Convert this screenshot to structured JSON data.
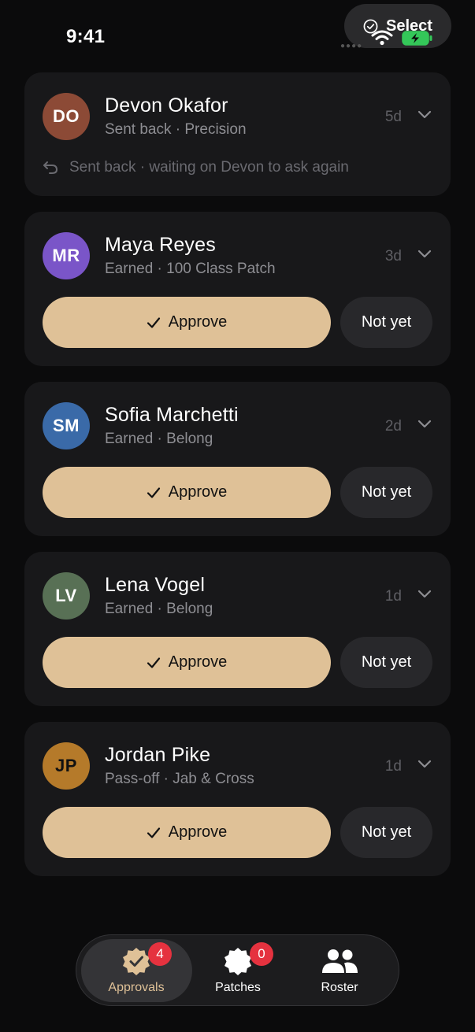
{
  "status_bar": {
    "time": "9:41"
  },
  "header": {
    "select_label": "Select"
  },
  "requests": [
    {
      "initials": "DO",
      "name": "Devon Okafor",
      "subtitle": "Sent back · Precision",
      "age": "5d",
      "avatar_color": "#8c4a36",
      "avatar_text_color": "#ffffff",
      "note": "Sent back · waiting on Devon to ask again"
    },
    {
      "initials": "MR",
      "name": "Maya Reyes",
      "subtitle": "Earned · 100 Class Patch",
      "age": "3d",
      "avatar_color": "#7a55c8",
      "avatar_text_color": "#ffffff",
      "approve_label": "Approve",
      "decline_label": "Not yet"
    },
    {
      "initials": "SM",
      "name": "Sofia Marchetti",
      "subtitle": "Earned · Belong",
      "age": "2d",
      "avatar_color": "#3a6aa8",
      "avatar_text_color": "#ffffff",
      "approve_label": "Approve",
      "decline_label": "Not yet"
    },
    {
      "initials": "LV",
      "name": "Lena Vogel",
      "subtitle": "Earned · Belong",
      "age": "1d",
      "avatar_color": "#587055",
      "avatar_text_color": "#ffffff",
      "approve_label": "Approve",
      "decline_label": "Not yet"
    },
    {
      "initials": "JP",
      "name": "Jordan Pike",
      "subtitle": "Pass-off · Jab & Cross",
      "age": "1d",
      "avatar_color": "#b57a2a",
      "avatar_text_color": "#111111",
      "approve_label": "Approve",
      "decline_label": "Not yet"
    }
  ],
  "tabbar": {
    "tabs": [
      {
        "label": "Approvals",
        "icon": "approval-seal-icon",
        "badge": "4",
        "active": true
      },
      {
        "label": "Patches",
        "icon": "patch-badge-icon",
        "badge": "0",
        "active": false
      },
      {
        "label": "Roster",
        "icon": "people-icon",
        "active": false
      }
    ]
  },
  "colors": {
    "accent": "#dfc197",
    "card": "#18181a",
    "badge": "#e5323f",
    "background": "#0b0b0c"
  }
}
